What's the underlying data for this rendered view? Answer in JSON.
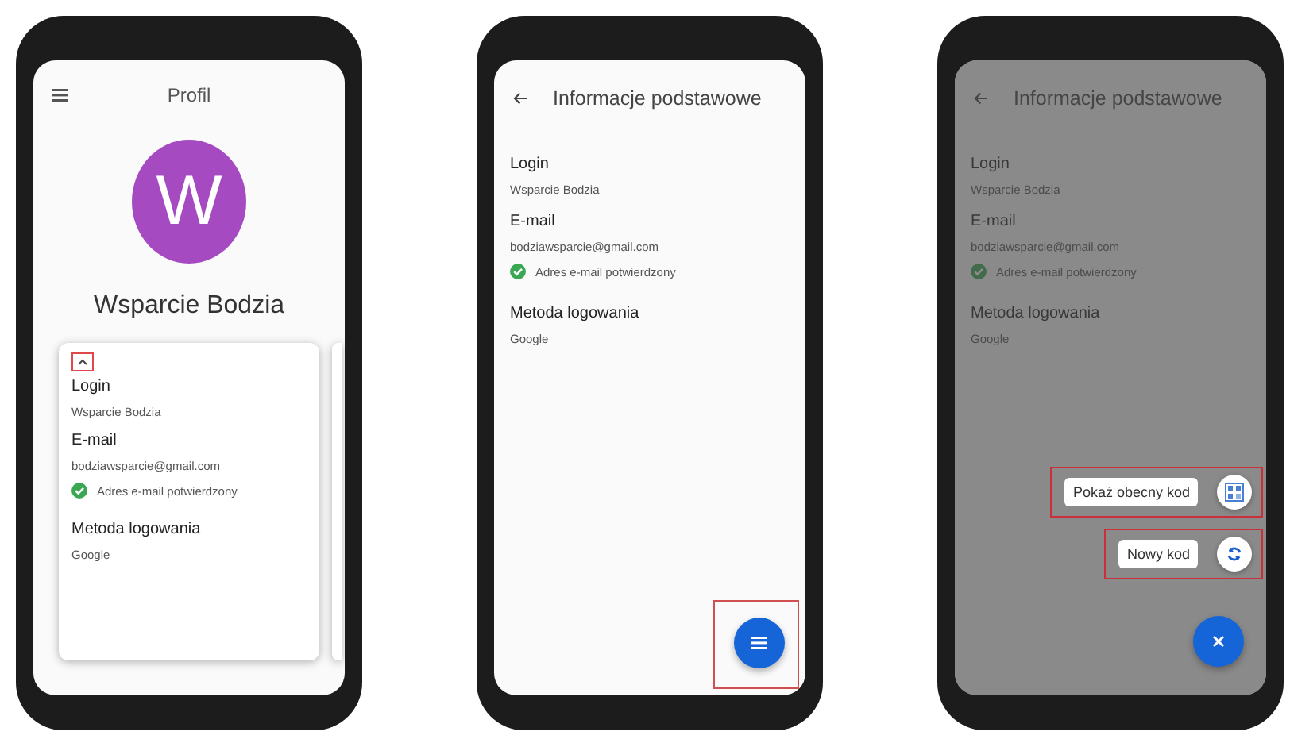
{
  "phones": [
    {
      "kind": "profile",
      "title": "Profil",
      "avatar_letter": "W",
      "name": "Wsparcie Bodzia",
      "toggle_highlighted": true,
      "dimmed": false,
      "fields": [
        {
          "label": "Login",
          "value": "Wsparcie Bodzia"
        },
        {
          "label": "E-mail",
          "value": "bodziawsparcie@gmail.com",
          "verified": "Adres e-mail potwierdzony"
        },
        {
          "label": "Metoda logowania",
          "value": "Google"
        }
      ]
    },
    {
      "kind": "details",
      "title": "Informacje podstawowe",
      "dimmed": false,
      "fields": [
        {
          "label": "Login",
          "value": "Wsparcie Bodzia"
        },
        {
          "label": "E-mail",
          "value": "bodziawsparcie@gmail.com",
          "verified": "Adres e-mail potwierdzony"
        },
        {
          "label": "Metoda logowania",
          "value": "Google"
        }
      ],
      "fab": {
        "kind": "menu",
        "highlighted": true
      }
    },
    {
      "kind": "details",
      "title": "Informacje podstawowe",
      "dimmed": true,
      "fields": [
        {
          "label": "Login",
          "value": "Wsparcie Bodzia"
        },
        {
          "label": "E-mail",
          "value": "bodziawsparcie@gmail.com",
          "verified": "Adres e-mail potwierdzony"
        },
        {
          "label": "Metoda logowania",
          "value": "Google"
        }
      ],
      "speed_dial": [
        {
          "label": "Pokaż obecny kod",
          "kind": "qr",
          "highlighted": true
        },
        {
          "label": "Nowy kod",
          "kind": "refresh",
          "highlighted": true
        }
      ],
      "fab": {
        "kind": "close",
        "highlighted": false
      }
    }
  ]
}
